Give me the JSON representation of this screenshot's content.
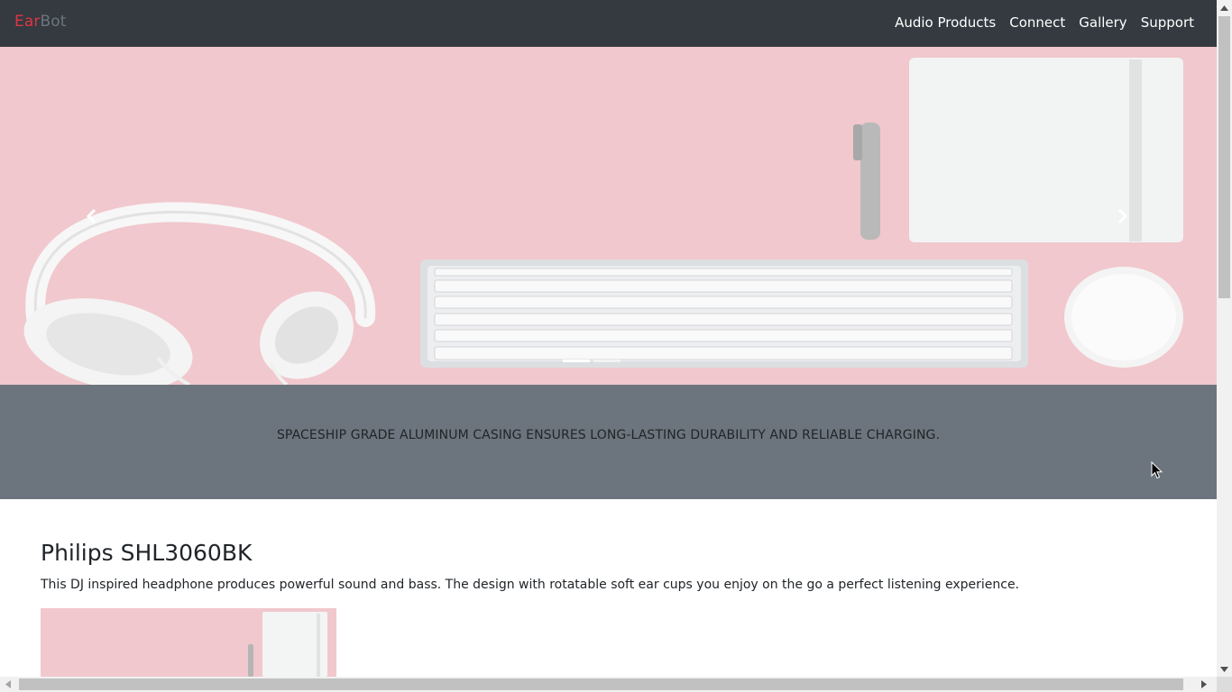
{
  "navbar": {
    "brand_part1": "Ear",
    "brand_part2": "Bot",
    "links": [
      "Audio Products",
      "Connect",
      "Gallery",
      "Support"
    ]
  },
  "carousel": {
    "image": "desk-headphones-keyboard-photo",
    "prev_icon": "chevron-left-icon",
    "next_icon": "chevron-right-icon",
    "indicator_count": 2,
    "active_indicator": 1
  },
  "caption": {
    "text": "SPACESHIP GRADE ALUMINUM CASING ENSURES LONG-LASTING DURABILITY AND RELIABLE CHARGING."
  },
  "product": {
    "title": "Philips SHL3060BK",
    "description": "This DJ inspired headphone produces powerful sound and bass. The design with rotatable soft ear cups you enjoy on the go a perfect listening experience."
  },
  "colors": {
    "navbar_bg": "#343a40",
    "brand_red": "#dc3545",
    "brand_gray": "#6c757d",
    "caption_bg": "#6c757d",
    "hero_pink": "#f1c8cd"
  }
}
